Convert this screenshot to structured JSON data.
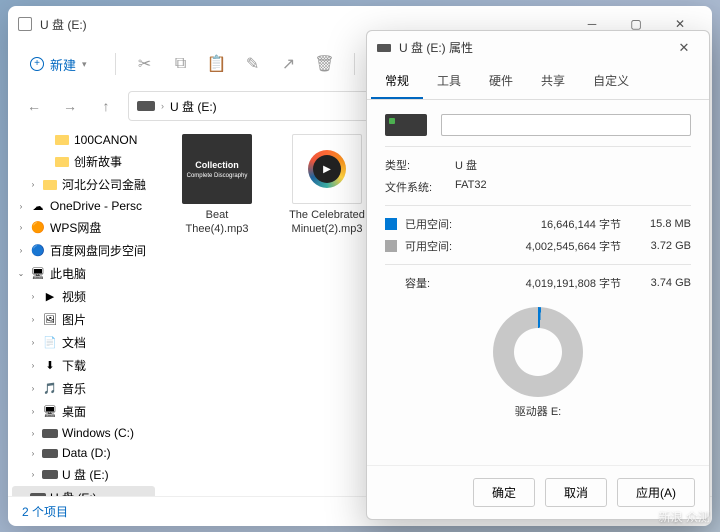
{
  "explorer": {
    "title": "U 盘 (E:)",
    "new_label": "新建",
    "address_label": "U 盘 (E:)",
    "status": "2 个项目",
    "sidebar": [
      {
        "label": "100CANON",
        "icon": "folder",
        "chev": "",
        "indent": 2
      },
      {
        "label": "创新故事",
        "icon": "folder",
        "chev": "",
        "indent": 2
      },
      {
        "label": "河北分公司金融",
        "icon": "folder",
        "chev": ">",
        "indent": 1
      },
      {
        "label": "OneDrive - Persc",
        "icon": "cloud",
        "chev": ">",
        "indent": 0
      },
      {
        "label": "WPS网盘",
        "icon": "wps",
        "chev": ">",
        "indent": 0
      },
      {
        "label": "百度网盘同步空间",
        "icon": "baidu",
        "chev": ">",
        "indent": 0
      },
      {
        "label": "此电脑",
        "icon": "pc",
        "chev": "v",
        "indent": 0
      },
      {
        "label": "视频",
        "icon": "video",
        "chev": ">",
        "indent": 1
      },
      {
        "label": "图片",
        "icon": "image",
        "chev": ">",
        "indent": 1
      },
      {
        "label": "文档",
        "icon": "doc",
        "chev": ">",
        "indent": 1
      },
      {
        "label": "下载",
        "icon": "download",
        "chev": ">",
        "indent": 1
      },
      {
        "label": "音乐",
        "icon": "music",
        "chev": ">",
        "indent": 1
      },
      {
        "label": "桌面",
        "icon": "desktop",
        "chev": ">",
        "indent": 1
      },
      {
        "label": "Windows (C:)",
        "icon": "drive",
        "chev": ">",
        "indent": 1
      },
      {
        "label": "Data (D:)",
        "icon": "drive",
        "chev": ">",
        "indent": 1
      },
      {
        "label": "U 盘 (E:)",
        "icon": "drive",
        "chev": ">",
        "indent": 1
      },
      {
        "label": "U 盘 (E:)",
        "icon": "drive",
        "chev": ">",
        "indent": 0,
        "selected": true
      }
    ],
    "files": [
      {
        "name": "Beat Thee(4).mp3",
        "thumb_text1": "Collection",
        "thumb_text2": "Complete Discography"
      },
      {
        "name": "The Celebrated Minuet(2).mp3",
        "media": true
      }
    ]
  },
  "props": {
    "title": "U 盘 (E:) 属性",
    "tabs": [
      "常规",
      "工具",
      "硬件",
      "共享",
      "自定义"
    ],
    "type_label": "类型:",
    "type_value": "U 盘",
    "fs_label": "文件系统:",
    "fs_value": "FAT32",
    "used_label": "已用空间:",
    "used_bytes": "16,646,144 字节",
    "used_size": "15.8 MB",
    "free_label": "可用空间:",
    "free_bytes": "4,002,545,664 字节",
    "free_size": "3.72 GB",
    "capacity_label": "容量:",
    "capacity_bytes": "4,019,191,808 字节",
    "capacity_size": "3.74 GB",
    "drive_label": "驱动器 E:",
    "ok": "确定",
    "cancel": "取消",
    "apply": "应用(A)"
  },
  "watermark": "新浪\n众测"
}
